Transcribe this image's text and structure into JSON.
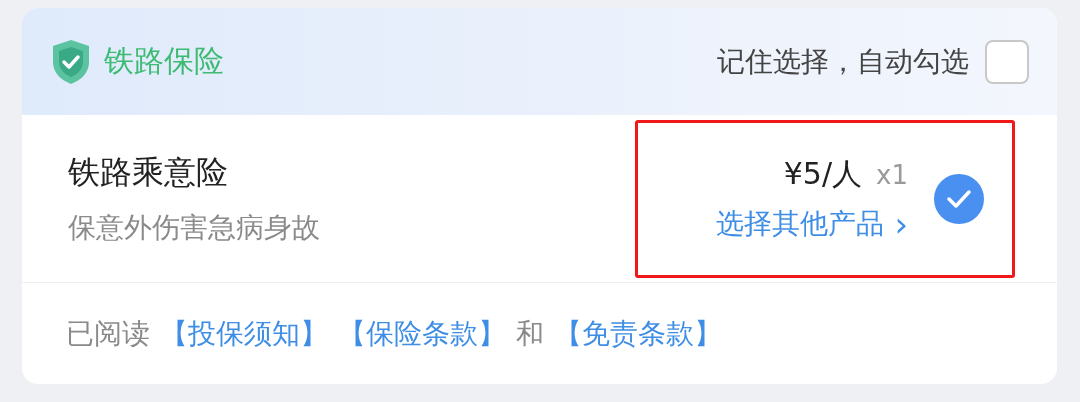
{
  "header": {
    "title": "铁路保险",
    "remember_label": "记住选择，自动勾选",
    "remember_checked": false
  },
  "product": {
    "name": "铁路乘意险",
    "description": "保意外伤害急病身故",
    "price": "¥5/人",
    "quantity": "x1",
    "change_link": "选择其他产品",
    "chevron": "›",
    "selected": true,
    "highlighted": true
  },
  "footer": [
    {
      "kind": "text",
      "text": "已阅读"
    },
    {
      "kind": "link",
      "text": "【投保须知】"
    },
    {
      "kind": "link",
      "text": "【保险条款】"
    },
    {
      "kind": "text",
      "text": "和"
    },
    {
      "kind": "link",
      "text": "【免责条款】"
    }
  ]
}
